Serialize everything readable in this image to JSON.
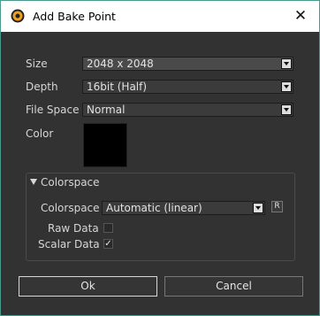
{
  "window": {
    "title": "Add Bake Point",
    "close_symbol": "✕",
    "icon": "nuke-app-icon"
  },
  "fields": {
    "size_label": "Size",
    "size_value": "2048 x 2048",
    "depth_label": "Depth",
    "depth_value": "16bit (Half)",
    "filespace_label": "File Space",
    "filespace_value": "Normal",
    "color_label": "Color",
    "color_value": "#000000"
  },
  "colorspace_group": {
    "title": "Colorspace",
    "colorspace_label": "Colorspace",
    "colorspace_value": "Automatic (linear)",
    "reset_button": "R",
    "raw_data_label": "Raw Data",
    "raw_data_checked": false,
    "scalar_data_label": "Scalar Data",
    "scalar_data_checked": true,
    "check_mark": "✓"
  },
  "buttons": {
    "ok": "Ok",
    "cancel": "Cancel"
  },
  "colors": {
    "accent_border": "#4a9a8e",
    "background": "#323232"
  }
}
